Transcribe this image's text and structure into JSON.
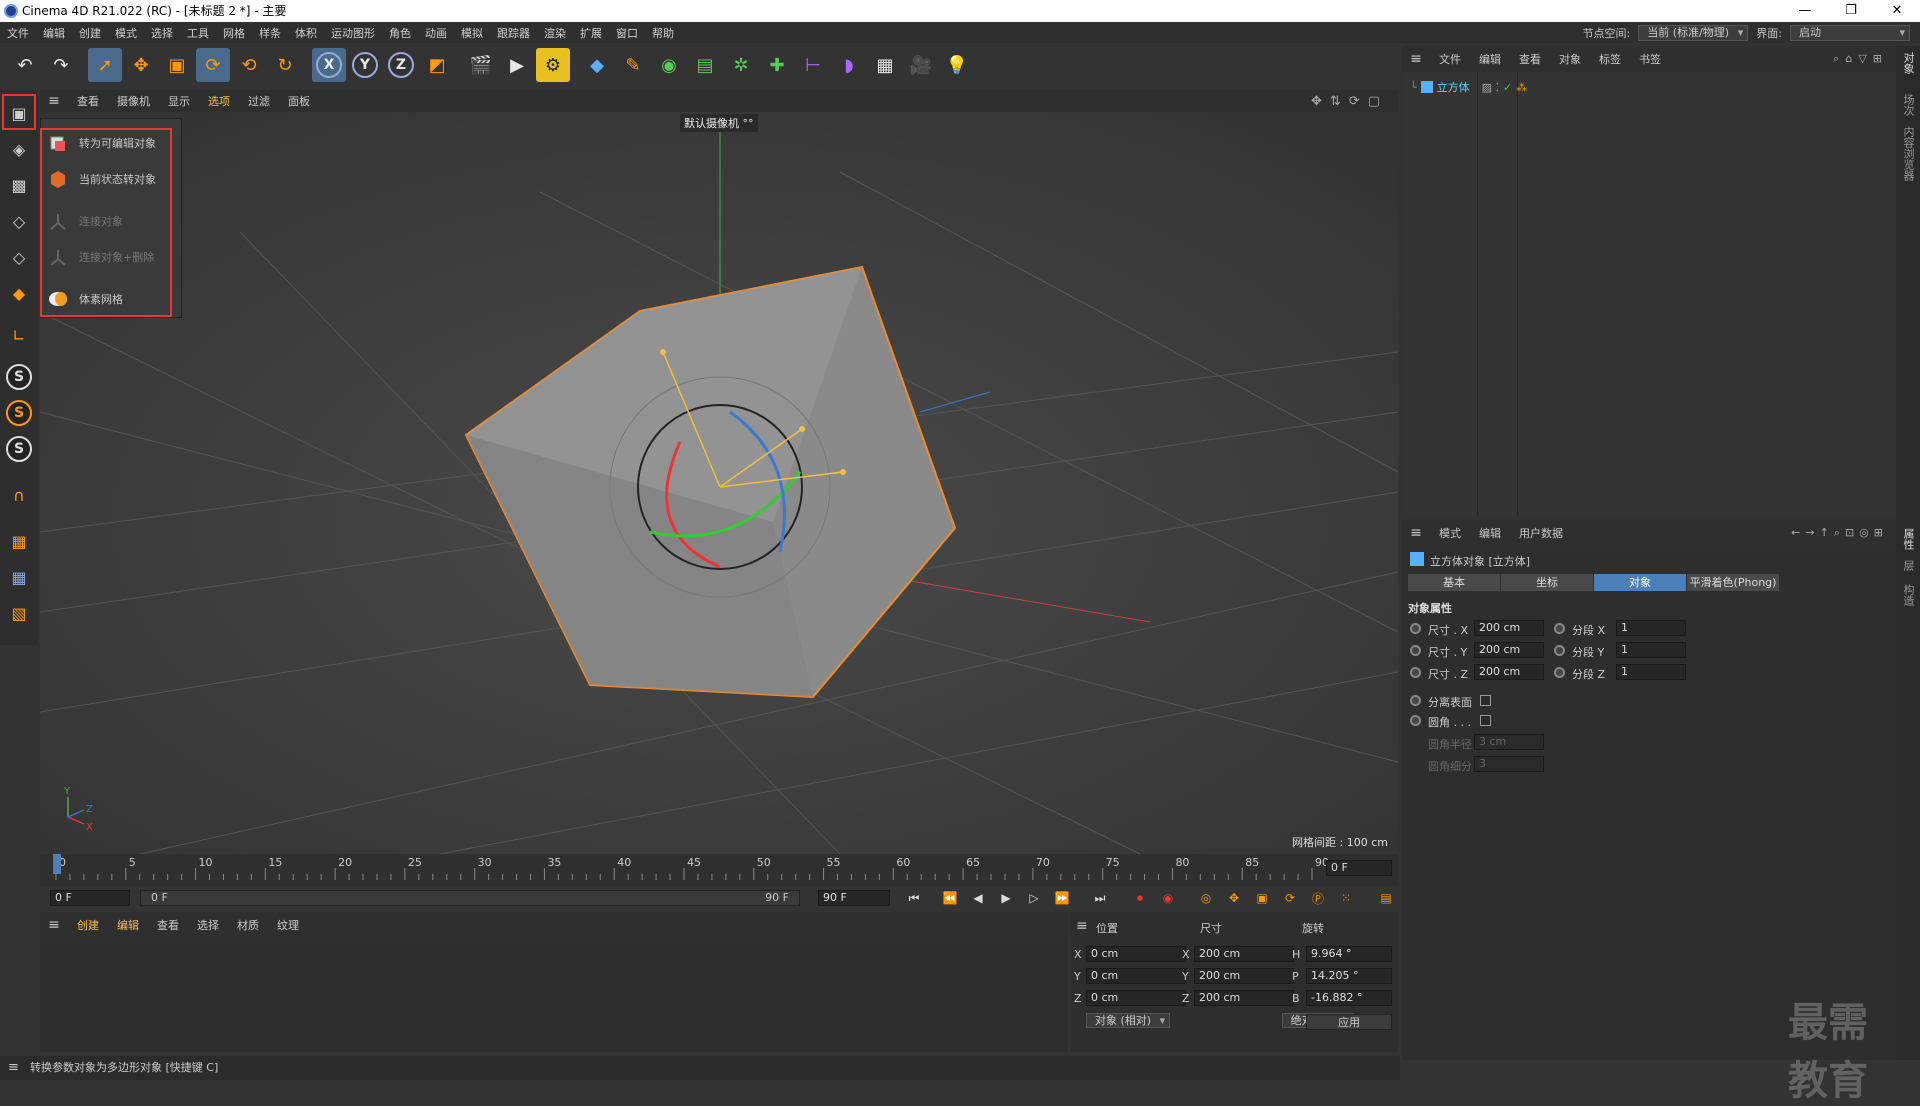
{
  "window": {
    "title": "Cinema 4D R21.022 (RC) - [未标题 2 *] - 主要",
    "minimize": "—",
    "maximize": "❐",
    "close": "✕"
  },
  "menubar": {
    "items": [
      "文件",
      "编辑",
      "创建",
      "模式",
      "选择",
      "工具",
      "网格",
      "样条",
      "体积",
      "运动图形",
      "角色",
      "动画",
      "模拟",
      "跟踪器",
      "渲染",
      "扩展",
      "窗口",
      "帮助"
    ],
    "node_space_label": "节点空间:",
    "node_space_value": "当前 (标准/物理)",
    "interface_label": "界面:",
    "interface_value": "启动"
  },
  "viewport": {
    "menu": [
      "查看",
      "摄像机",
      "显示",
      "选项",
      "过滤",
      "面板"
    ],
    "camera_label": "默认摄像机 °°",
    "grid_spacing": "网格间距 : 100 cm",
    "axis_y": "Y",
    "axis_z": "Z",
    "axis_x": "X"
  },
  "popup": {
    "items": [
      {
        "label": "转为可编辑对象",
        "enabled": true
      },
      {
        "label": "当前状态转对象",
        "enabled": true
      },
      {
        "label": "连接对象",
        "enabled": false
      },
      {
        "label": "连接对象+删除",
        "enabled": false
      },
      {
        "label": "体素网格",
        "enabled": true
      }
    ]
  },
  "timeline": {
    "ticks": [
      "0",
      "5",
      "10",
      "15",
      "20",
      "25",
      "30",
      "35",
      "40",
      "45",
      "50",
      "55",
      "60",
      "65",
      "70",
      "75",
      "80",
      "85",
      "90"
    ],
    "current_frame": "0 F",
    "start_frame": "0 F",
    "range_start": "0 F",
    "range_end": "90 F",
    "end_frame": "90 F"
  },
  "material": {
    "menu": [
      "创建",
      "编辑",
      "查看",
      "选择",
      "材质",
      "纹理"
    ]
  },
  "coords": {
    "headers": [
      "位置",
      "尺寸",
      "旋转"
    ],
    "rows": [
      {
        "axis": "X",
        "pos": "0 cm",
        "size_axis": "X",
        "size": "200 cm",
        "rot_axis": "H",
        "rot": "9.964 °"
      },
      {
        "axis": "Y",
        "pos": "0 cm",
        "size_axis": "Y",
        "size": "200 cm",
        "rot_axis": "P",
        "rot": "14.205 °"
      },
      {
        "axis": "Z",
        "pos": "0 cm",
        "size_axis": "Z",
        "size": "200 cm",
        "rot_axis": "B",
        "rot": "-16.882 °"
      }
    ],
    "mode": "对象 (相对)",
    "size_mode": "绝对尺寸",
    "apply": "应用"
  },
  "status": {
    "text": "转换参数对象为多边形对象 [快捷键 C]"
  },
  "object_manager": {
    "menu": [
      "文件",
      "编辑",
      "查看",
      "对象",
      "标签",
      "书签"
    ],
    "object_name": "立方体"
  },
  "attribute_manager": {
    "menu": [
      "模式",
      "编辑",
      "用户数据"
    ],
    "title": "立方体对象 [立方体]",
    "tabs": [
      {
        "label": "基本",
        "active": false
      },
      {
        "label": "坐标",
        "active": false
      },
      {
        "label": "对象",
        "active": true
      },
      {
        "label": "平滑着色(Phong)",
        "active": false
      }
    ],
    "section": "对象属性",
    "size_rows": [
      {
        "label": "尺寸 . X",
        "value": "200 cm",
        "seg_label": "分段 X",
        "seg": "1"
      },
      {
        "label": "尺寸 . Y",
        "value": "200 cm",
        "seg_label": "分段 Y",
        "seg": "1"
      },
      {
        "label": "尺寸 . Z",
        "value": "200 cm",
        "seg_label": "分段 Z",
        "seg": "1"
      }
    ],
    "separate_surfaces": "分离表面",
    "fillet": "圆角 . . .",
    "fillet_radius_label": "圆角半径",
    "fillet_radius": "3 cm",
    "fillet_subdiv_label": "圆角细分",
    "fillet_subdiv": "3"
  },
  "right_strip": {
    "tabs": [
      "对象",
      "场次",
      "内容浏览器"
    ],
    "lower_tabs": [
      "属性",
      "层",
      "构造"
    ]
  },
  "watermark": "最需教育",
  "colors": {
    "accent": "#4c7fb8",
    "highlight_red": "#e33333",
    "selection_orange": "#f08a2a"
  }
}
